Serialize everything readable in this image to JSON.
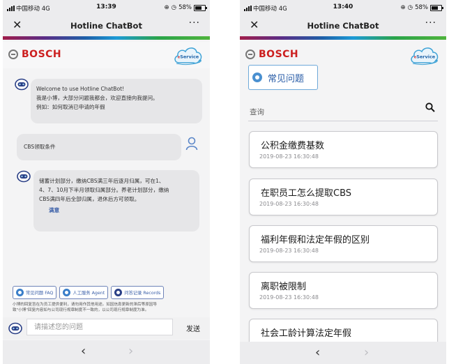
{
  "left": {
    "status": {
      "carrier": "中国移动",
      "network": "4G",
      "time": "13:39",
      "battery": "58%"
    },
    "header": {
      "close": "✕",
      "title": "Hotline ChatBot",
      "more": "···"
    },
    "brand": {
      "name": "BOSCH",
      "service": "Service"
    },
    "chat": {
      "welcome": {
        "line1": "Welcome to use Hotline ChatBot!",
        "line2": "我是小博，大部分问题我都会，欢迎直接向我提问。",
        "line3": "例如：如何取消已申请的年假"
      },
      "user_msg": "CBS领取条件",
      "answer": {
        "line1": "储蓄计划部分，缴纳CBS满三年后逐月归属，可在1、",
        "line2": "4、7、10月下半月领取归属部分。养老计划部分，缴纳",
        "line3": "CBS满四年后全部归属，退休后方可领取。",
        "satisfied": "满意"
      }
    },
    "quick": {
      "faq": "常见问题 FAQ",
      "agent": "人工服务 Agent",
      "records": "问答记录 Records"
    },
    "disclaimer": {
      "line1": "小博的回复旨在为员工提供便利，请勿用作其他用途。如因信息更新的滞后等原因导",
      "line2": "致\"小博\"回复内容如与公司现行规章制度不一致的，以公司现行规章制度为准。"
    },
    "input": {
      "placeholder": "请描述您的问题",
      "send": "发送"
    },
    "nav": {
      "back": "‹",
      "forward": "›"
    }
  },
  "right": {
    "status": {
      "carrier": "中国移动",
      "network": "4G",
      "time": "13:40",
      "battery": "58%"
    },
    "header": {
      "close": "✕",
      "title": "Hotline ChatBot",
      "more": "···"
    },
    "brand": {
      "name": "BOSCH",
      "service": "Service"
    },
    "tab": "常见问题",
    "search": {
      "placeholder": "查询"
    },
    "faqs": [
      {
        "q": "公积金缴费基数",
        "date": "2019-08-23 16:30:48"
      },
      {
        "q": "在职员工怎么提取CBS",
        "date": "2019-08-23 16:30:48"
      },
      {
        "q": "福利年假和法定年假的区别",
        "date": "2019-08-23 16:30:48"
      },
      {
        "q": "离职被限制",
        "date": "2019-08-23 16:30:48"
      },
      {
        "q": "社会工龄计算法定年假",
        "date": ""
      }
    ],
    "nav": {
      "back": "‹",
      "forward": "›"
    }
  },
  "colors": {
    "bosch_red": "#cc1f1f",
    "accent_blue": "#3a5fa8",
    "bubble": "#e6e6e8"
  },
  "icons": [
    "close-icon",
    "more-icon",
    "bosch-logo-icon",
    "eservice-cloud-icon",
    "robot-icon",
    "user-icon",
    "search-icon",
    "chevron-left-icon",
    "chevron-right-icon"
  ]
}
